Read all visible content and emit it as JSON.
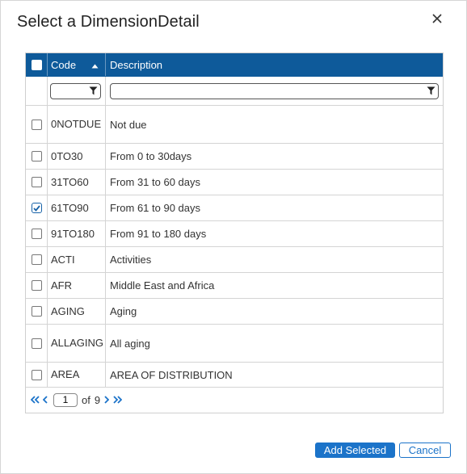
{
  "dialog": {
    "title": "Select a DimensionDetail",
    "close_icon": "close-icon"
  },
  "grid": {
    "columns": {
      "code": "Code",
      "description": "Description"
    },
    "sort_icon": "sort-ascending-icon",
    "filter_icon": "filter-icon",
    "filters": {
      "code_value": "",
      "description_value": ""
    },
    "rows": [
      {
        "code": "0NOTDUE",
        "description": "Not due",
        "checked": false
      },
      {
        "code": "0TO30",
        "description": "From 0 to 30days",
        "checked": false
      },
      {
        "code": "31TO60",
        "description": "From 31 to 60 days",
        "checked": false
      },
      {
        "code": "61TO90",
        "description": "From 61 to 90 days",
        "checked": true
      },
      {
        "code": "91TO180",
        "description": "From 91 to 180 days",
        "checked": false
      },
      {
        "code": "ACTI",
        "description": "Activities",
        "checked": false
      },
      {
        "code": "AFR",
        "description": "Middle East and Africa",
        "checked": false
      },
      {
        "code": "AGING",
        "description": "Aging",
        "checked": false
      },
      {
        "code": "ALLAGING",
        "description": "All aging",
        "checked": false
      },
      {
        "code": "AREA",
        "description": "AREA OF DISTRIBUTION",
        "checked": false
      }
    ],
    "pager": {
      "current_page": "1",
      "of_label": "of",
      "total_pages": "9",
      "icons": [
        "first-page-icon",
        "previous-page-icon",
        "next-page-icon",
        "last-page-icon"
      ]
    }
  },
  "buttons": {
    "add_selected": "Add Selected",
    "cancel": "Cancel"
  },
  "colors": {
    "header_bg": "#0e5a9a",
    "accent": "#1b73c9",
    "check": "#1762a8"
  }
}
